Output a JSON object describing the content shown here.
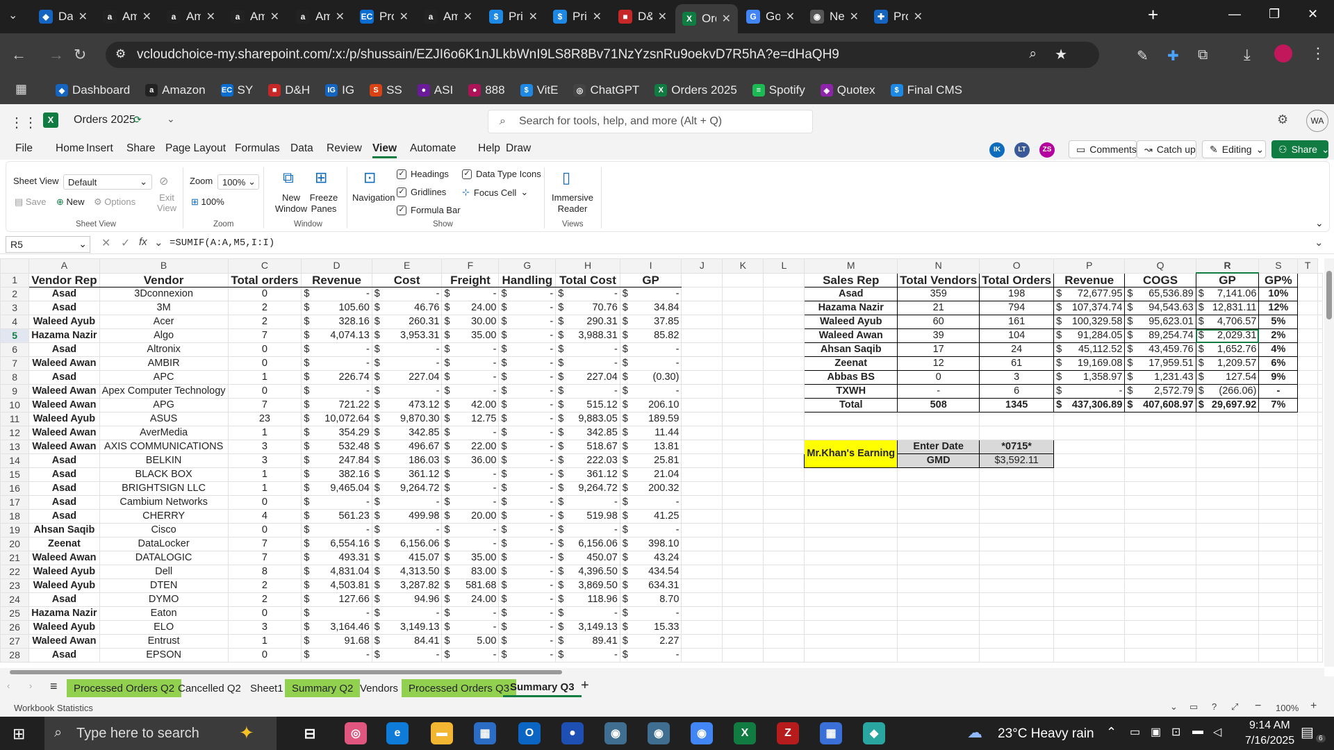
{
  "browser": {
    "tabs": [
      {
        "title": "Das",
        "color": "#1565c0",
        "glyph": "◆"
      },
      {
        "title": "Am",
        "color": "#222",
        "glyph": "a"
      },
      {
        "title": "Am",
        "color": "#222",
        "glyph": "a"
      },
      {
        "title": "Am",
        "color": "#222",
        "glyph": "a"
      },
      {
        "title": "Am",
        "color": "#222",
        "glyph": "a"
      },
      {
        "title": "Pro",
        "color": "#0a6ed1",
        "glyph": "EC"
      },
      {
        "title": "Am",
        "color": "#222",
        "glyph": "a"
      },
      {
        "title": "Pric",
        "color": "#1e88e5",
        "glyph": "$"
      },
      {
        "title": "Pric",
        "color": "#1e88e5",
        "glyph": "$"
      },
      {
        "title": "D&",
        "color": "#c62828",
        "glyph": "■"
      },
      {
        "title": "Ord",
        "color": "#107c41",
        "glyph": "X"
      },
      {
        "title": "Goo",
        "color": "#4285f4",
        "glyph": "G"
      },
      {
        "title": "Nev",
        "color": "#555",
        "glyph": "◉"
      },
      {
        "title": "Pro",
        "color": "#1565c0",
        "glyph": "✚"
      }
    ],
    "url": "vcloudchoice-my.sharepoint.com/:x:/p/shussain/EZJI6o6K1nJLkbWnI9LS8R8Bv71NzYzsnRu9oekvD7R5hA?e=dHaQH9",
    "bookmarks": [
      {
        "label": "Dashboard",
        "color": "#1565c0",
        "glyph": "◆"
      },
      {
        "label": "Amazon",
        "color": "#222",
        "glyph": "a"
      },
      {
        "label": "SY",
        "color": "#0a6ed1",
        "glyph": "EC"
      },
      {
        "label": "D&H",
        "color": "#c62828",
        "glyph": "■"
      },
      {
        "label": "IG",
        "color": "#1565c0",
        "glyph": "IG"
      },
      {
        "label": "SS",
        "color": "#d84315",
        "glyph": "S"
      },
      {
        "label": "ASI",
        "color": "#6a1b9a",
        "glyph": "●"
      },
      {
        "label": "888",
        "color": "#ad1457",
        "glyph": "●"
      },
      {
        "label": "VitE",
        "color": "#1e88e5",
        "glyph": "$"
      },
      {
        "label": "ChatGPT",
        "color": "#444",
        "glyph": "◎"
      },
      {
        "label": "Orders 2025",
        "color": "#107c41",
        "glyph": "X"
      },
      {
        "label": "Spotify",
        "color": "#1db954",
        "glyph": "≡"
      },
      {
        "label": "Quotex",
        "color": "#8e24aa",
        "glyph": "◈"
      },
      {
        "label": "Final CMS",
        "color": "#1e88e5",
        "glyph": "$"
      }
    ]
  },
  "excel": {
    "doc_title": "Orders 2025",
    "search_placeholder": "Search for tools, help, and more (Alt + Q)",
    "menu": [
      "File",
      "Home",
      "Insert",
      "Share",
      "Page Layout",
      "Formulas",
      "Data",
      "Review",
      "View",
      "Automate",
      "Help",
      "Draw"
    ],
    "active_menu": "View",
    "presence": [
      "IK",
      "LT",
      "ZS"
    ],
    "comments": "Comments",
    "catchup": "Catch up",
    "editing": "Editing",
    "share": "Share",
    "ribbon": {
      "sheet_view_label": "Sheet View",
      "sheet_view_value": "Default",
      "save": "Save",
      "new": "New",
      "options": "Options",
      "exit_view": "Exit View",
      "group_sheet_view": "Sheet View",
      "zoom_label": "Zoom",
      "zoom_value": "100%",
      "zoom_100": "100%",
      "group_zoom": "Zoom",
      "new_window": "New Window",
      "freeze_panes": "Freeze Panes",
      "group_window": "Window",
      "navigation": "Navigation",
      "headings": "Headings",
      "gridlines": "Gridlines",
      "formula_bar": "Formula Bar",
      "data_type_icons": "Data Type Icons",
      "focus_cell": "Focus Cell",
      "group_show": "Show",
      "immersive_reader": "Immersive Reader",
      "group_views": "Views"
    },
    "name_box": "R5",
    "formula": "=SUMIF(A:A,M5,I:I)",
    "columns": [
      "A",
      "B",
      "C",
      "D",
      "E",
      "F",
      "G",
      "H",
      "I",
      "J",
      "K",
      "L",
      "M",
      "N",
      "O",
      "P",
      "Q",
      "R",
      "S",
      "T"
    ],
    "headers": [
      "Vendor Rep",
      "Vendor",
      "Total orders",
      "Revenue",
      "Cost",
      "Freight",
      "Handling",
      "Total Cost",
      "GP"
    ],
    "rows": [
      [
        "Asad",
        "3Dconnexion",
        "0",
        "-",
        "-",
        "-",
        "-",
        "-",
        "-"
      ],
      [
        "Asad",
        "3M",
        "2",
        "105.60",
        "46.76",
        "24.00",
        "-",
        "70.76",
        "34.84"
      ],
      [
        "Waleed Ayub",
        "Acer",
        "2",
        "328.16",
        "260.31",
        "30.00",
        "-",
        "290.31",
        "37.85"
      ],
      [
        "Hazama Nazir",
        "Algo",
        "7",
        "4,074.13",
        "3,953.31",
        "35.00",
        "-",
        "3,988.31",
        "85.82"
      ],
      [
        "Asad",
        "Altronix",
        "0",
        "-",
        "-",
        "-",
        "-",
        "-",
        "-"
      ],
      [
        "Waleed Awan",
        "AMBIR",
        "0",
        "-",
        "-",
        "-",
        "-",
        "-",
        "-"
      ],
      [
        "Asad",
        "APC",
        "1",
        "226.74",
        "227.04",
        "-",
        "-",
        "227.04",
        "(0.30)"
      ],
      [
        "Waleed Awan",
        "Apex Computer Technology",
        "0",
        "-",
        "-",
        "-",
        "-",
        "-",
        "-"
      ],
      [
        "Waleed Awan",
        "APG",
        "7",
        "721.22",
        "473.12",
        "42.00",
        "-",
        "515.12",
        "206.10"
      ],
      [
        "Waleed Ayub",
        "ASUS",
        "23",
        "10,072.64",
        "9,870.30",
        "12.75",
        "-",
        "9,883.05",
        "189.59"
      ],
      [
        "Waleed Awan",
        "AverMedia",
        "1",
        "354.29",
        "342.85",
        "-",
        "-",
        "342.85",
        "11.44"
      ],
      [
        "Waleed Awan",
        "AXIS COMMUNICATIONS",
        "3",
        "532.48",
        "496.67",
        "22.00",
        "-",
        "518.67",
        "13.81"
      ],
      [
        "Asad",
        "BELKIN",
        "3",
        "247.84",
        "186.03",
        "36.00",
        "-",
        "222.03",
        "25.81"
      ],
      [
        "Asad",
        "BLACK BOX",
        "1",
        "382.16",
        "361.12",
        "-",
        "-",
        "361.12",
        "21.04"
      ],
      [
        "Asad",
        "BRIGHTSIGN LLC",
        "1",
        "9,465.04",
        "9,264.72",
        "-",
        "-",
        "9,264.72",
        "200.32"
      ],
      [
        "Asad",
        "Cambium Networks",
        "0",
        "-",
        "-",
        "-",
        "-",
        "-",
        "-"
      ],
      [
        "Asad",
        "CHERRY",
        "4",
        "561.23",
        "499.98",
        "20.00",
        "-",
        "519.98",
        "41.25"
      ],
      [
        "Ahsan Saqib",
        "Cisco",
        "0",
        "-",
        "-",
        "-",
        "-",
        "-",
        "-"
      ],
      [
        "Zeenat",
        "DataLocker",
        "7",
        "6,554.16",
        "6,156.06",
        "-",
        "-",
        "6,156.06",
        "398.10"
      ],
      [
        "Waleed Awan",
        "DATALOGIC",
        "7",
        "493.31",
        "415.07",
        "35.00",
        "-",
        "450.07",
        "43.24"
      ],
      [
        "Waleed Ayub",
        "Dell",
        "8",
        "4,831.04",
        "4,313.50",
        "83.00",
        "-",
        "4,396.50",
        "434.54"
      ],
      [
        "Waleed Ayub",
        "DTEN",
        "2",
        "4,503.81",
        "3,287.82",
        "581.68",
        "-",
        "3,869.50",
        "634.31"
      ],
      [
        "Asad",
        "DYMO",
        "2",
        "127.66",
        "94.96",
        "24.00",
        "-",
        "118.96",
        "8.70"
      ],
      [
        "Hazama Nazir",
        "Eaton",
        "0",
        "-",
        "-",
        "-",
        "-",
        "-",
        "-"
      ],
      [
        "Waleed Ayub",
        "ELO",
        "3",
        "3,164.46",
        "3,149.13",
        "-",
        "-",
        "3,149.13",
        "15.33"
      ],
      [
        "Waleed Awan",
        "Entrust",
        "1",
        "91.68",
        "84.41",
        "5.00",
        "-",
        "89.41",
        "2.27"
      ],
      [
        "Asad",
        "EPSON",
        "0",
        "-",
        "-",
        "-",
        "-",
        "-",
        "-"
      ]
    ],
    "summary_headers": [
      "Sales Rep",
      "Total Vendors",
      "Total Orders",
      "Revenue",
      "COGS",
      "GP",
      "GP%"
    ],
    "summary_rows": [
      [
        "Asad",
        "359",
        "198",
        "72,677.95",
        "65,536.89",
        "7,141.06",
        "10%"
      ],
      [
        "Hazama Nazir",
        "21",
        "794",
        "107,374.74",
        "94,543.63",
        "12,831.11",
        "12%"
      ],
      [
        "Waleed Ayub",
        "60",
        "161",
        "100,329.58",
        "95,623.01",
        "4,706.57",
        "5%"
      ],
      [
        "Waleed Awan",
        "39",
        "104",
        "91,284.05",
        "89,254.74",
        "2,029.31",
        "2%"
      ],
      [
        "Ahsan Saqib",
        "17",
        "24",
        "45,112.52",
        "43,459.76",
        "1,652.76",
        "4%"
      ],
      [
        "Zeenat",
        "12",
        "61",
        "19,169.08",
        "17,959.51",
        "1,209.57",
        "6%"
      ],
      [
        "Abbas BS",
        "0",
        "3",
        "1,358.97",
        "1,231.43",
        "127.54",
        "9%"
      ],
      [
        "TXWH",
        "-",
        "6",
        "-",
        "2,572.79",
        "(266.06)",
        "-"
      ],
      [
        "Total",
        "508",
        "1345",
        "437,306.89",
        "407,608.97",
        "29,697.92",
        "7%"
      ]
    ],
    "earning": {
      "label": "Mr.Khan's Earning",
      "enter_date": "Enter Date",
      "date_value": "*0715*",
      "gmd": "GMD",
      "gmd_value": "$3,592.11"
    },
    "currency": "$",
    "sheets": [
      {
        "name": "Processed Orders Q2",
        "green": true
      },
      {
        "name": "Cancelled Q2",
        "green": false
      },
      {
        "name": "Sheet1",
        "green": false
      },
      {
        "name": "Summary Q2",
        "green": true
      },
      {
        "name": "Vendors",
        "green": false
      },
      {
        "name": "Processed Orders Q3",
        "green": true
      },
      {
        "name": "Summary Q3",
        "green": false,
        "active": true
      }
    ],
    "status_left": "Workbook Statistics",
    "status_zoom": "100%"
  },
  "taskbar": {
    "search_placeholder": "Type here to search",
    "weather": "23°C  Heavy rain",
    "time": "9:14 AM",
    "date": "7/16/2025",
    "notif": "6"
  }
}
